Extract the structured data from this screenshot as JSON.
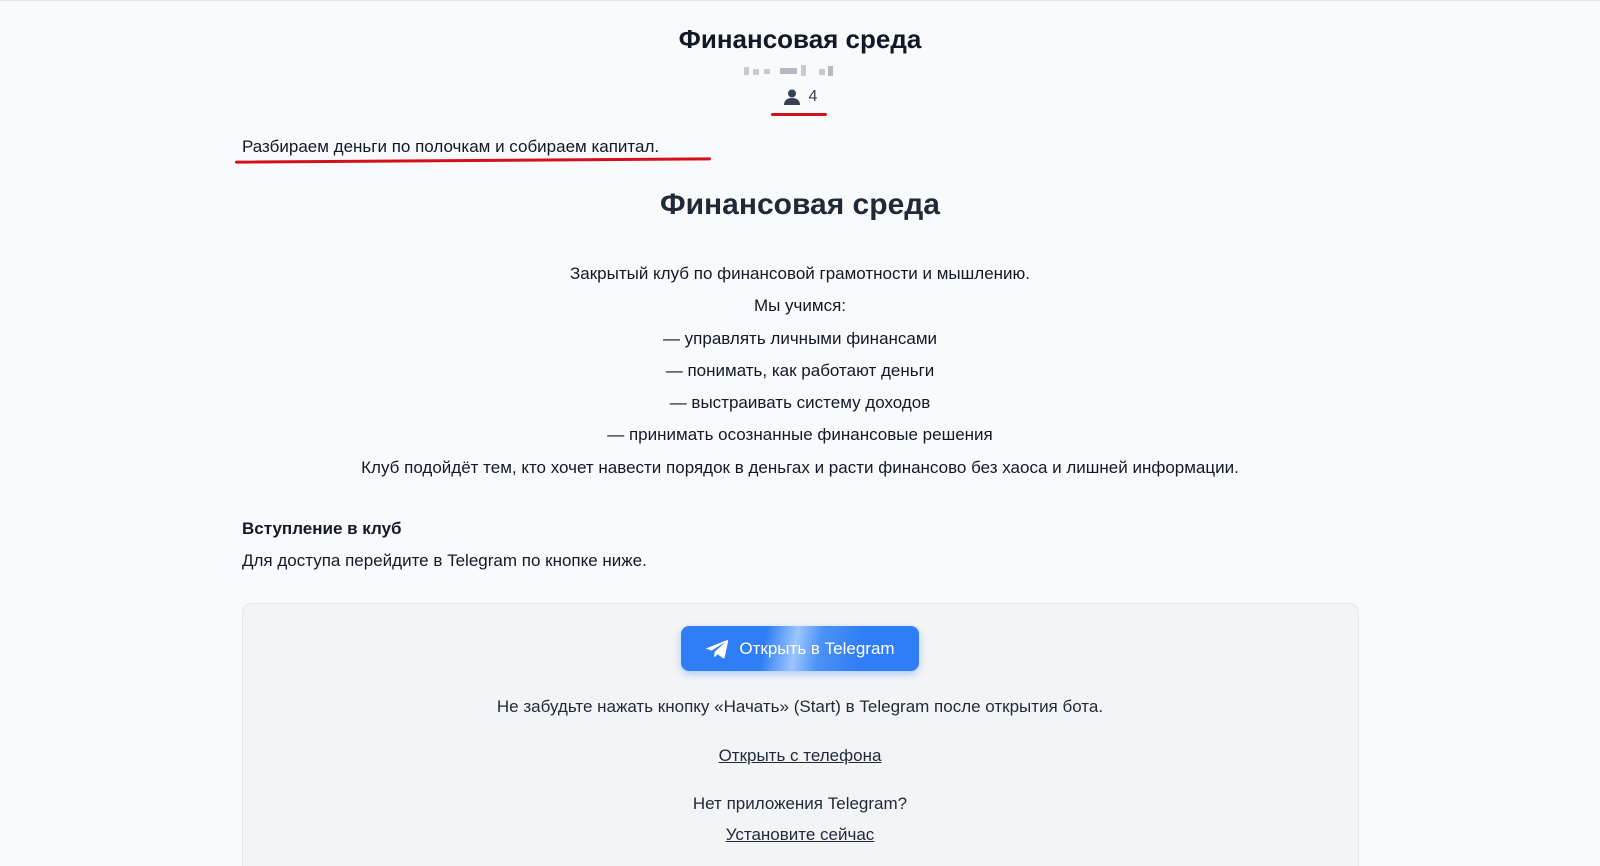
{
  "header": {
    "channel_title": "Финансовая среда",
    "member_count": "4"
  },
  "tagline": "Разбираем деньги по полочкам и собираем капитал.",
  "main": {
    "title": "Финансовая среда",
    "description_lines": [
      "Закрытый клуб по финансовой грамотности и мышлению.",
      "Мы учимся:",
      "— управлять личными финансами",
      "— понимать, как работают деньги",
      "— выстраивать систему доходов",
      "— принимать осознанные финансовые решения",
      "Клуб подойдёт тем, кто хочет навести порядок в деньгах и расти финансово без хаоса и лишней информации."
    ]
  },
  "join": {
    "heading": "Вступление в клуб",
    "text": "Для доступа перейдите в Telegram по кнопке ниже."
  },
  "card": {
    "button_label": "Открыть в Telegram",
    "hint": "Не забудьте нажать кнопку «Начать» (Start) в Telegram после открытия бота.",
    "phone_link": "Открыть с телефона",
    "no_app_text": "Нет приложения Telegram?",
    "install_link": "Установите сейчас"
  },
  "icons": {
    "members": "person-icon",
    "button": "telegram-send-icon"
  },
  "colors": {
    "accent": "#2f7ef5",
    "annotation_underline": "#d4111b",
    "background": "#f9fafb",
    "card_background": "#f3f4f6"
  }
}
